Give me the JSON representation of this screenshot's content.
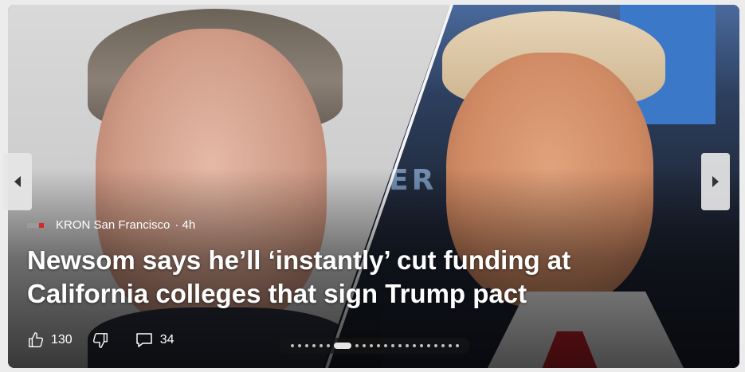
{
  "article": {
    "source": "KRON San Francisco",
    "age": "· 4h",
    "headline_line1": "Newsom says he’ll ‘instantly’ cut funding at",
    "headline_line2": "California colleges that sign Trump pact"
  },
  "image_text": "ER",
  "actions": {
    "likes": "130",
    "comments": "34"
  },
  "carousel": {
    "dot_count": 22,
    "active_index": 6
  },
  "icons": {
    "source_logo": "kron-logo-icon",
    "like": "thumbs-up-icon",
    "dislike": "thumbs-down-icon",
    "comment": "comment-icon",
    "prev": "chevron-left-icon",
    "next": "chevron-right-icon"
  },
  "colors": {
    "headline_text": "#ffffff",
    "tie_red": "#c8232b",
    "panel_blue": "#3c78c8"
  }
}
